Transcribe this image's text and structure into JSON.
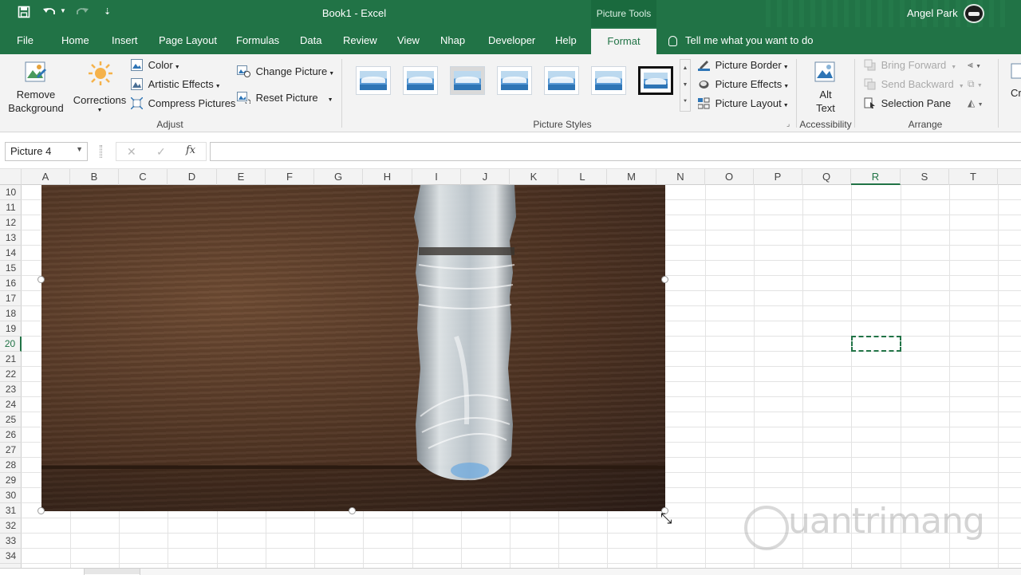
{
  "titlebar": {
    "document_title": "Book1  -  Excel",
    "context_title": "Picture Tools",
    "user_name": "Angel Park"
  },
  "tabs": [
    "File",
    "Home",
    "Insert",
    "Page Layout",
    "Formulas",
    "Data",
    "Review",
    "View",
    "Nhap",
    "Developer",
    "Help",
    "Format"
  ],
  "active_tab": "Format",
  "tell_me": "Tell me what you want to do",
  "ribbon": {
    "adjust": {
      "remove_background": "Remove Background",
      "remove_background_l1": "Remove",
      "remove_background_l2": "Background",
      "corrections": "Corrections",
      "color": "Color",
      "artistic_effects": "Artistic Effects",
      "compress_pictures": "Compress Pictures",
      "change_picture": "Change Picture",
      "reset_picture": "Reset Picture",
      "group_label": "Adjust"
    },
    "picture_styles": {
      "group_label": "Picture Styles",
      "picture_border": "Picture Border",
      "picture_effects": "Picture Effects",
      "picture_layout": "Picture Layout"
    },
    "accessibility": {
      "alt_text_l1": "Alt",
      "alt_text_l2": "Text",
      "group_label": "Accessibility"
    },
    "arrange": {
      "bring_forward": "Bring Forward",
      "send_backward": "Send Backward",
      "selection_pane": "Selection Pane",
      "group_label": "Arrange",
      "crop_partial": "Cr"
    }
  },
  "formula_bar": {
    "name_box": "Picture 4",
    "fx": "fx",
    "formula": ""
  },
  "columns": [
    "A",
    "B",
    "C",
    "D",
    "E",
    "F",
    "G",
    "H",
    "I",
    "J",
    "K",
    "L",
    "M",
    "N",
    "O",
    "P",
    "Q",
    "R",
    "S",
    "T"
  ],
  "selected_column": "R",
  "rows": [
    "10",
    "11",
    "12",
    "13",
    "14",
    "15",
    "16",
    "17",
    "18",
    "19",
    "20",
    "21",
    "22",
    "23",
    "24",
    "25",
    "26",
    "27",
    "28",
    "29",
    "30",
    "31",
    "32",
    "33",
    "34"
  ],
  "selected_row": "20",
  "watermark": "uantrimang",
  "colors": {
    "excel_green": "#217346",
    "ribbon_bg": "#f3f3f3"
  }
}
